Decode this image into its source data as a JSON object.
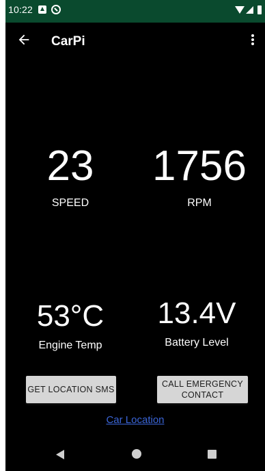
{
  "status_bar": {
    "time": "10:22",
    "icons": [
      "notification-a-icon",
      "do-not-disturb-icon",
      "wifi-icon",
      "signal-icon",
      "battery-icon"
    ],
    "background_color": "#0a4a2e"
  },
  "app_bar": {
    "title": "CarPi",
    "back_icon": "arrow-back-icon",
    "menu_icon": "more-vert-icon"
  },
  "metrics": {
    "speed": {
      "value": "23",
      "label": "SPEED"
    },
    "rpm": {
      "value": "1756",
      "label": "RPM"
    },
    "engine_temp": {
      "value": "53°C",
      "label": "Engine Temp"
    },
    "battery": {
      "value": "13.4V",
      "label": "Battery Level"
    }
  },
  "actions": {
    "get_location_sms": "GET LOCATION SMS",
    "call_emergency_contact": "CALL EMERGENCY CONTACT",
    "car_location_link": "Car Location"
  },
  "nav_bar": {
    "icons": [
      "nav-back-icon",
      "nav-home-icon",
      "nav-recents-icon"
    ]
  },
  "colors": {
    "background": "#000000",
    "text": "#ffffff",
    "button": "#d6d6d6",
    "link": "#3b66d9"
  }
}
